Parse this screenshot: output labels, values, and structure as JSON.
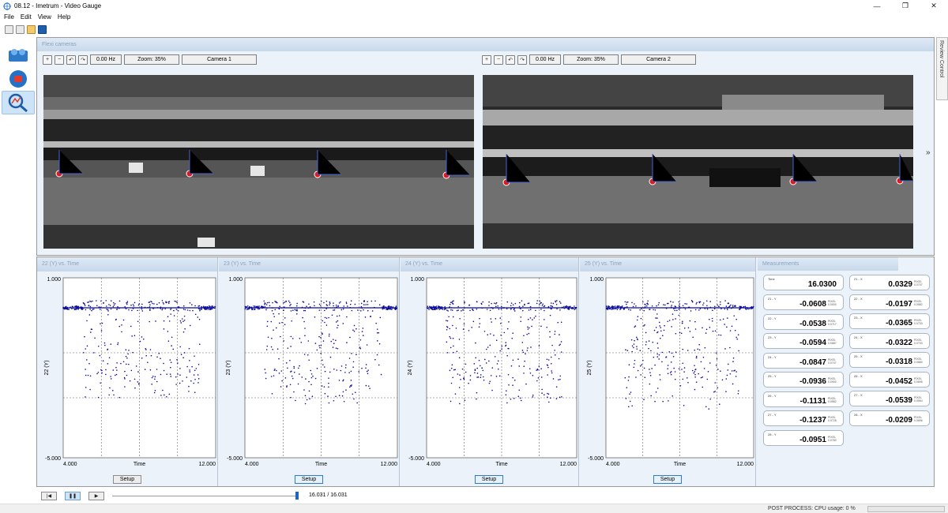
{
  "window": {
    "title": "08.12 - Imetrum - Video Gauge",
    "minimize": "—",
    "restore": "❐",
    "close": "✕",
    "icon": "imetrum-logo-icon"
  },
  "menu": [
    "File",
    "Edit",
    "View",
    "Help"
  ],
  "toolbar_icons": [
    "camera-icon",
    "save-frame-icon",
    "open-project-icon",
    "save-icon"
  ],
  "left_tools": [
    "cameras-tool-icon",
    "record-tool-icon",
    "analysis-tool-icon"
  ],
  "cameras": {
    "header": "Flexi cameras",
    "cam1": {
      "freq": "0.00 Hz",
      "zoom": "Zoom: 35%",
      "name": "Camera 1"
    },
    "cam2": {
      "freq": "0.00 Hz",
      "zoom": "Zoom: 35%",
      "name": "Camera 2"
    }
  },
  "review_control": "Review Control",
  "chevron": "»",
  "charts": [
    {
      "title": "22 (Y) vs. Time",
      "ylabel": "22 (Y)",
      "setup": "Setup",
      "active": false
    },
    {
      "title": "23 (Y) vs. Time",
      "ylabel": "23 (Y)",
      "setup": "Setup",
      "active": true
    },
    {
      "title": "24 (Y) vs. Time",
      "ylabel": "24 (Y)",
      "setup": "Setup",
      "active": true
    },
    {
      "title": "25 (Y) vs. Time",
      "ylabel": "25 (Y)",
      "setup": "Setup",
      "active": true
    }
  ],
  "chart_axes": {
    "y_top": "1.000",
    "y_bottom": "-5.000",
    "x_left": "4.000",
    "x_right": "12.000",
    "xlabel": "Time"
  },
  "chart_data": [
    {
      "type": "scatter",
      "title": "22 (Y) vs. Time",
      "xlabel": "Time",
      "ylabel": "22 (Y)",
      "xlim": [
        4,
        12
      ],
      "ylim": [
        -5,
        1
      ],
      "series": [
        {
          "x_range": [
            4.0,
            12.0
          ],
          "y_baseline": 0.0,
          "y_min": -3.0
        }
      ]
    },
    {
      "type": "scatter",
      "title": "23 (Y) vs. Time",
      "xlabel": "Time",
      "ylabel": "23 (Y)",
      "xlim": [
        4,
        12
      ],
      "ylim": [
        -5,
        1
      ],
      "series": [
        {
          "x_range": [
            4.0,
            12.0
          ],
          "y_baseline": 0.0,
          "y_min": -3.2
        }
      ]
    },
    {
      "type": "scatter",
      "title": "24 (Y) vs. Time",
      "xlabel": "Time",
      "ylabel": "24 (Y)",
      "xlim": [
        4,
        12
      ],
      "ylim": [
        -5,
        1
      ],
      "series": [
        {
          "x_range": [
            4.0,
            12.0
          ],
          "y_baseline": 0.0,
          "y_min": -3.2
        }
      ]
    },
    {
      "type": "scatter",
      "title": "25 (Y) vs. Time",
      "xlabel": "Time",
      "ylabel": "25 (Y)",
      "xlim": [
        4,
        12
      ],
      "ylim": [
        -5,
        1
      ],
      "series": [
        {
          "x_range": [
            4.0,
            12.0
          ],
          "y_baseline": 0.0,
          "y_min": -3.4
        }
      ]
    }
  ],
  "measurements": {
    "header": "Measurements",
    "time": {
      "label": "Time",
      "value": "16.0300"
    },
    "left": [
      {
        "label": "21 - Y",
        "value": "-0.0608",
        "unit": "PIXEL 0.0000"
      },
      {
        "label": "22 - Y",
        "value": "-0.0538",
        "unit": "PIXEL 0.0717"
      },
      {
        "label": "23 - Y",
        "value": "-0.0594",
        "unit": "PIXEL 0.0687"
      },
      {
        "label": "24 - Y",
        "value": "-0.0847",
        "unit": "PIXEL 0.0747"
      },
      {
        "label": "25 - Y",
        "value": "-0.0936",
        "unit": "PIXEL 0.0900"
      },
      {
        "label": "26 - Y",
        "value": "-0.1131",
        "unit": "PIXEL 0.0582"
      },
      {
        "label": "27 - Y",
        "value": "-0.1237",
        "unit": "PIXEL 0.0728"
      },
      {
        "label": "28 - Y",
        "value": "-0.0951",
        "unit": "PIXEL 0.0780"
      }
    ],
    "right": [
      {
        "label": "21 - X",
        "value": "0.0329",
        "unit": "PIXEL 0.0707"
      },
      {
        "label": "22 - X",
        "value": "-0.0197",
        "unit": "PIXEL 0.0582"
      },
      {
        "label": "23 - X",
        "value": "-0.0365",
        "unit": "PIXEL 0.0733"
      },
      {
        "label": "24 - X",
        "value": "-0.0322",
        "unit": "PIXEL 0.0733"
      },
      {
        "label": "25 - X",
        "value": "-0.0318",
        "unit": "PIXEL 0.0680"
      },
      {
        "label": "26 - X",
        "value": "-0.0452",
        "unit": "PIXEL 0.0695"
      },
      {
        "label": "27 - X",
        "value": "-0.0539",
        "unit": "PIXEL 0.0594"
      },
      {
        "label": "28 - X",
        "value": "-0.0209",
        "unit": "PIXEL 0.0696"
      }
    ]
  },
  "transport": {
    "rewind": "|◀",
    "pause": "❚❚",
    "play": "▶",
    "position": "16.031 / 16.031"
  },
  "status": {
    "text": "POST PROCESS: CPU usage:   0 %"
  }
}
